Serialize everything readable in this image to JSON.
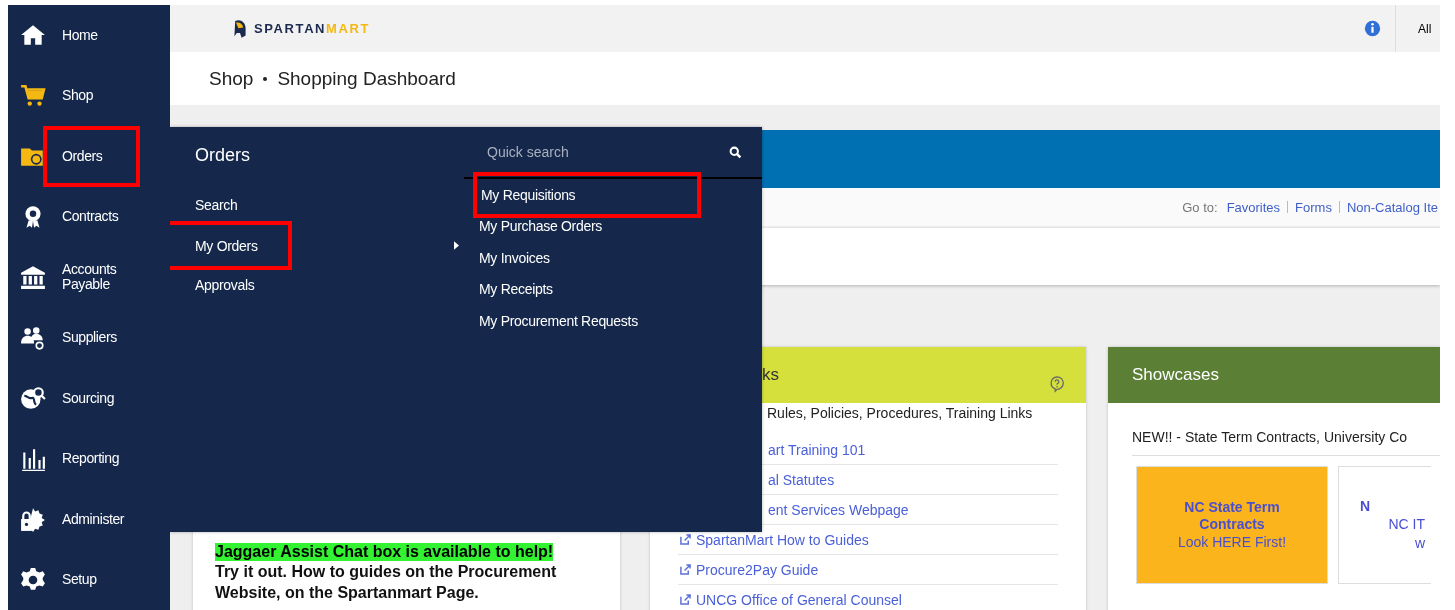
{
  "sidebar": {
    "items": [
      {
        "label": "Home",
        "highlighted": false
      },
      {
        "label": "Shop",
        "highlighted": false
      },
      {
        "label": "Orders",
        "highlighted": true
      },
      {
        "label": "Contracts",
        "highlighted": false
      },
      {
        "label": "Accounts Payable",
        "highlighted": false
      },
      {
        "label": "Suppliers",
        "highlighted": false
      },
      {
        "label": "Sourcing",
        "highlighted": false
      },
      {
        "label": "Reporting",
        "highlighted": false
      },
      {
        "label": "Administer",
        "highlighted": false
      },
      {
        "label": "Setup",
        "highlighted": false
      }
    ]
  },
  "header": {
    "brand_primary": "SPARTAN",
    "brand_secondary": "MART",
    "scope": "All"
  },
  "breadcrumb": [
    "Shop",
    "Shopping Dashboard"
  ],
  "goto": {
    "label": "Go to:",
    "links": [
      "Favorites",
      "Forms",
      "Non-Catalog Ite"
    ]
  },
  "flyout": {
    "title": "Orders",
    "items": [
      {
        "label": "Search",
        "highlighted": false,
        "submenu": false
      },
      {
        "label": "My Orders",
        "highlighted": true,
        "submenu": true
      },
      {
        "label": "Approvals",
        "highlighted": false,
        "submenu": false
      }
    ],
    "search": {
      "placeholder": "Quick search"
    },
    "subitems": [
      {
        "label": "My Requisitions",
        "highlighted": true
      },
      {
        "label": "My Purchase Orders",
        "highlighted": false
      },
      {
        "label": "My Invoices",
        "highlighted": false
      },
      {
        "label": "My Receipts",
        "highlighted": false
      },
      {
        "label": "My Procurement Requests",
        "highlighted": false
      }
    ]
  },
  "notice_card": {
    "highlight": "Jaggaer Assist Chat box is available to help!",
    "text": "Try it out. How to guides on the Procurement Website, on the Spartanmart Page."
  },
  "links_card": {
    "title": "ks",
    "subtitle": "Rules, Policies, Procedures, Training Links",
    "links": [
      {
        "label": "art Training 101",
        "kind": "covered"
      },
      {
        "label": "al Statutes",
        "kind": "covered"
      },
      {
        "label": "ent Services Webpage",
        "kind": "covered"
      },
      {
        "label": "SpartanMart How to Guides",
        "kind": "link"
      },
      {
        "label": "Procure2Pay Guide",
        "kind": "link"
      },
      {
        "label": "UNCG Office of General Counsel",
        "kind": "link"
      }
    ]
  },
  "showcases_card": {
    "title": "Showcases",
    "text": "NEW!! - State Term Contracts, University Co",
    "tiles": [
      {
        "title": "NC State Term Contracts",
        "text": "Look HERE First!",
        "kind": "featured"
      },
      {
        "title": "N",
        "text": "NC IT",
        "text_2": "w",
        "kind": "plain"
      }
    ]
  }
}
